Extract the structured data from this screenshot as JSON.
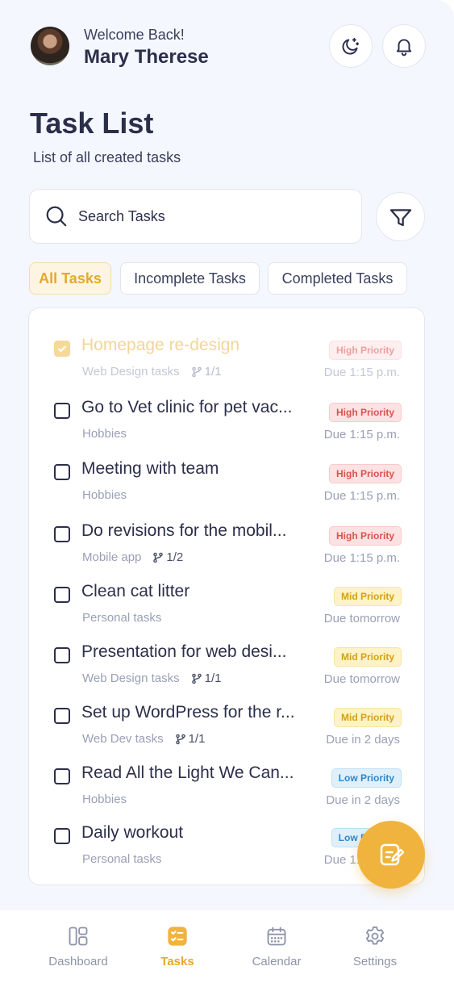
{
  "header": {
    "welcome": "Welcome Back!",
    "user_name": "Mary Therese"
  },
  "page": {
    "title": "Task List",
    "subtitle": "List of all created tasks"
  },
  "search": {
    "placeholder": "Search Tasks"
  },
  "tabs": [
    {
      "label": "All Tasks",
      "active": true
    },
    {
      "label": "Incomplete Tasks",
      "active": false
    },
    {
      "label": "Completed Tasks",
      "active": false
    }
  ],
  "tasks": [
    {
      "title": "Homepage re-design",
      "category": "Web Design tasks",
      "subtasks": "1/1",
      "priority": "High Priority",
      "level": "high",
      "due": "Due 1:15 p.m.",
      "done": true
    },
    {
      "title": "Go to Vet clinic for pet vac...",
      "category": "Hobbies",
      "subtasks": "",
      "priority": "High Priority",
      "level": "high",
      "due": "Due 1:15 p.m.",
      "done": false
    },
    {
      "title": "Meeting with team",
      "category": "Hobbies",
      "subtasks": "",
      "priority": "High Priority",
      "level": "high",
      "due": "Due 1:15 p.m.",
      "done": false
    },
    {
      "title": "Do revisions for the mobil...",
      "category": "Mobile app",
      "subtasks": "1/2",
      "priority": "High Priority",
      "level": "high",
      "due": "Due 1:15 p.m.",
      "done": false
    },
    {
      "title": "Clean cat litter",
      "category": "Personal tasks",
      "subtasks": "",
      "priority": "Mid Priority",
      "level": "mid",
      "due": "Due tomorrow",
      "done": false
    },
    {
      "title": "Presentation for web desi...",
      "category": "Web Design tasks",
      "subtasks": "1/1",
      "priority": "Mid Priority",
      "level": "mid",
      "due": "Due tomorrow",
      "done": false
    },
    {
      "title": "Set up WordPress for the r...",
      "category": "Web Dev tasks",
      "subtasks": "1/1",
      "priority": "Mid Priority",
      "level": "mid",
      "due": "Due in 2 days",
      "done": false
    },
    {
      "title": "Read All the Light We Can...",
      "category": "Hobbies",
      "subtasks": "",
      "priority": "Low Priority",
      "level": "low",
      "due": "Due in 2 days",
      "done": false
    },
    {
      "title": "Daily workout",
      "category": "Personal tasks",
      "subtasks": "",
      "priority": "Low Priority",
      "level": "low",
      "due": "Due 1:15 p.m.",
      "done": false
    }
  ],
  "nav": {
    "dashboard": "Dashboard",
    "tasks": "Tasks",
    "calendar": "Calendar",
    "settings": "Settings"
  },
  "colors": {
    "accent": "#f0b43e",
    "text": "#2b2f4a",
    "background": "#f4f7fe"
  }
}
